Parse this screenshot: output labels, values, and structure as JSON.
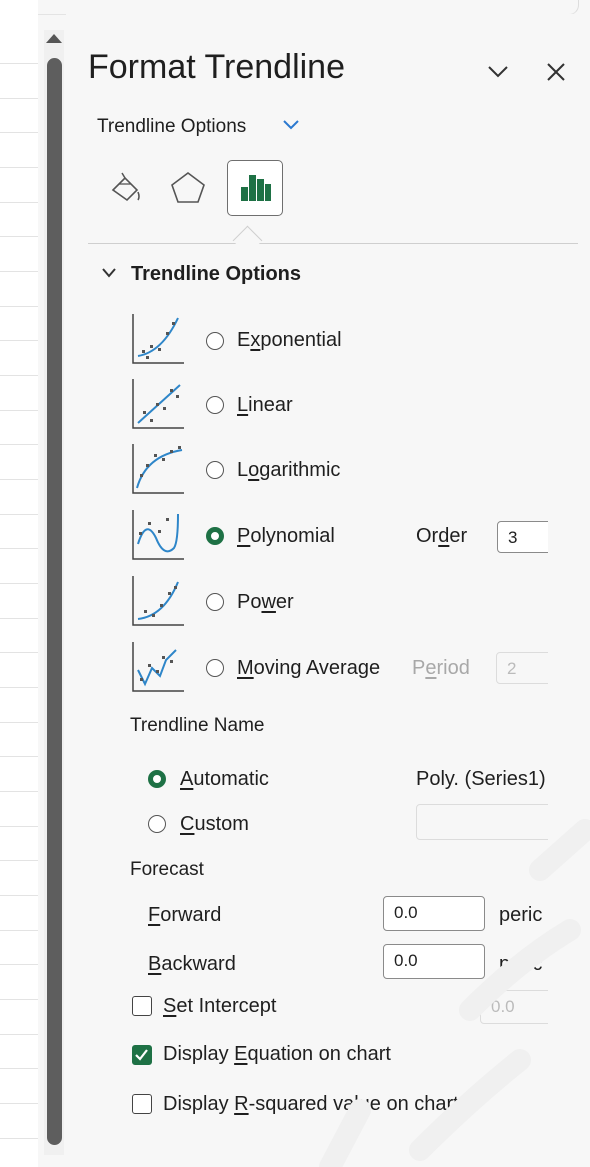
{
  "pane": {
    "title": "Format Trendline",
    "subtitle": "Trendline Options",
    "tabs": [
      "fill-line",
      "effects",
      "trendline-options"
    ],
    "section_title": "Trendline Options"
  },
  "trend_types": {
    "exponential": {
      "pre": "E",
      "u": "x",
      "post": "ponential",
      "selected": false
    },
    "linear": {
      "pre": "",
      "u": "L",
      "post": "inear",
      "selected": false
    },
    "logarithmic": {
      "pre": "L",
      "u": "o",
      "post": "garithmic",
      "selected": false
    },
    "polynomial": {
      "pre": "",
      "u": "P",
      "post": "olynomial",
      "selected": true
    },
    "power": {
      "pre": "Po",
      "u": "w",
      "post": "er",
      "selected": false
    },
    "moving_average": {
      "pre": "",
      "u": "M",
      "post": "oving Average",
      "selected": false
    }
  },
  "order": {
    "pre": "Or",
    "u": "d",
    "post": "er",
    "value": "3"
  },
  "period": {
    "pre": "P",
    "u": "e",
    "post": "riod",
    "value": "2"
  },
  "trendline_name": {
    "heading": "Trendline Name",
    "automatic": {
      "pre": "",
      "u": "A",
      "post": "utomatic",
      "selected": true
    },
    "automatic_value": "Poly. (Series1)",
    "custom": {
      "pre": "",
      "u": "C",
      "post": "ustom",
      "selected": false
    }
  },
  "forecast": {
    "heading": "Forecast",
    "forward": {
      "pre": "",
      "u": "F",
      "post": "orward",
      "value": "0.0",
      "unit": "peric"
    },
    "backward": {
      "pre": "",
      "u": "B",
      "post": "ackward",
      "value": "0.0",
      "unit": "peric"
    }
  },
  "options": {
    "set_intercept": {
      "pre": "",
      "u": "S",
      "post": "et Intercept",
      "checked": false,
      "value": "0.0"
    },
    "display_equation": {
      "pre": "Display ",
      "u": "E",
      "post": "quation on chart",
      "checked": true
    },
    "display_r2": {
      "pre": "Display ",
      "u": "R",
      "post": "-squared value on chart",
      "checked": false
    }
  },
  "colors": {
    "accent": "#1e7145",
    "chart_line": "#2e86c9",
    "watermark": "#f2f2f2"
  }
}
